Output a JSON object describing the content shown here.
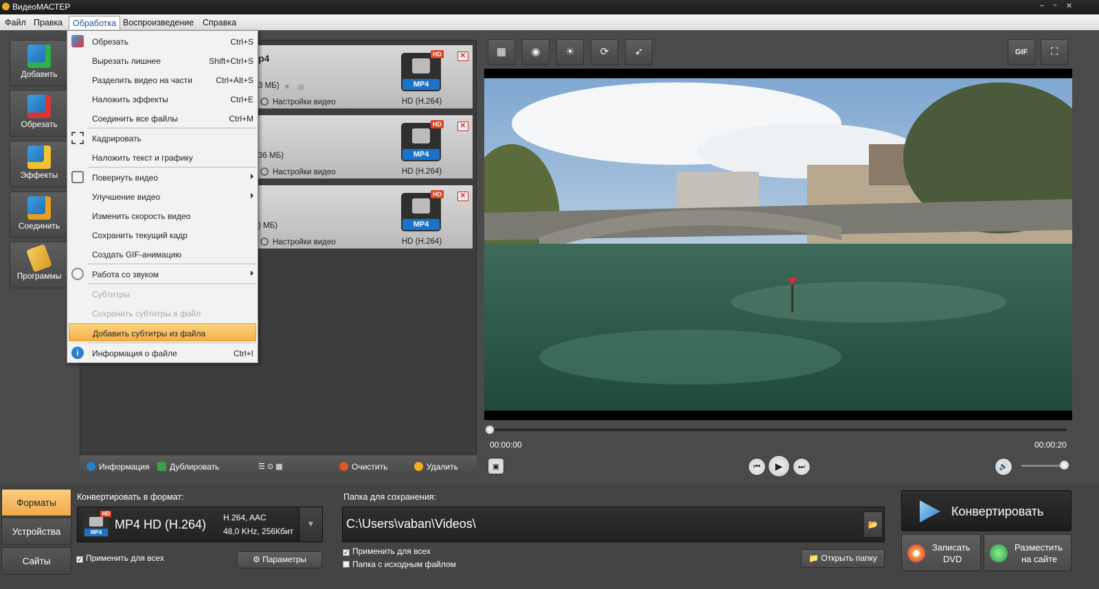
{
  "titlebar": {
    "title": "ВидеоМАСТЕР",
    "min": "–",
    "max": "▫",
    "close": "✕"
  },
  "menubar": {
    "items": [
      "Файл",
      "Правка",
      "Обработка",
      "Воспроизведение",
      "Справка"
    ]
  },
  "sidebar": {
    "items": [
      "Добавить",
      "Обрезать",
      "Эффекты",
      "Соединить",
      "Программы"
    ]
  },
  "files": [
    {
      "name_fragment": "p4",
      "size_fragment": "3 МБ)",
      "settings": "Настройки видео",
      "codec": "HD (H.264)",
      "badge": "MP4",
      "hd": "HD"
    },
    {
      "name_fragment": "",
      "size_fragment": "36 МБ)",
      "settings": "Настройки видео",
      "codec": "HD (H.264)",
      "badge": "MP4",
      "hd": "HD"
    },
    {
      "name_fragment": "",
      "size_fragment": ") МБ)",
      "settings": "Настройки видео",
      "codec": "HD (H.264)",
      "badge": "MP4",
      "hd": "HD"
    }
  ],
  "menu": {
    "items": [
      {
        "label": "Обрезать",
        "shortcut": "Ctrl+S"
      },
      {
        "label": "Вырезать лишнее",
        "shortcut": "Shift+Ctrl+S"
      },
      {
        "label": "Разделить видео на части",
        "shortcut": "Ctrl+Alt+S"
      },
      {
        "label": "Наложить эффекты",
        "shortcut": "Ctrl+E"
      },
      {
        "label": "Соединить все файлы",
        "shortcut": "Ctrl+M"
      },
      {
        "label": "Кадрировать",
        "shortcut": ""
      },
      {
        "label": "Наложить текст и графику",
        "shortcut": ""
      },
      {
        "label": "Повернуть видео",
        "shortcut": ""
      },
      {
        "label": "Улучшение видео",
        "shortcut": ""
      },
      {
        "label": "Изменить скорость видео",
        "shortcut": ""
      },
      {
        "label": "Сохранить текущий кадр",
        "shortcut": ""
      },
      {
        "label": "Создать GIF-анимацию",
        "shortcut": ""
      },
      {
        "label": "Работа со звуком",
        "shortcut": ""
      },
      {
        "label": "Субтитры",
        "shortcut": ""
      },
      {
        "label": "Сохранить субтитры в файл",
        "shortcut": ""
      },
      {
        "label": "Добавить субтитры из файла",
        "shortcut": ""
      },
      {
        "label": "Информация о файле",
        "shortcut": "Ctrl+I"
      }
    ]
  },
  "filelist_bar": {
    "info": "Информация",
    "duplicate": "Дублировать",
    "clear": "Очистить",
    "delete": "Удалить"
  },
  "toolbar": {
    "gif": "GIF"
  },
  "player": {
    "current": "00:00:00",
    "total": "00:00:20",
    "progress": 0.0,
    "volume": 1.0
  },
  "bottom": {
    "tabs": [
      "Форматы",
      "Устройства",
      "Сайты"
    ],
    "format_label": "Конвертировать в формат:",
    "format_name": "MP4 HD (H.264)",
    "format_badge": "MP4",
    "format_hd": "HD",
    "format_spec1": "H.264, AAC",
    "format_spec2": "48,0 KHz, 256Кбит",
    "apply_all": "Применить для всех",
    "params": "Параметры",
    "folder_label": "Папка для сохранения:",
    "folder_path": "C:\\Users\\vaban\\Videos\\",
    "apply_all2": "Применить для всех",
    "source_folder": "Папка с исходным файлом",
    "open_folder": "Открыть папку",
    "convert": "Конвертировать",
    "dvd1": "Записать",
    "dvd2": "DVD",
    "web1": "Разместить",
    "web2": "на сайте"
  }
}
